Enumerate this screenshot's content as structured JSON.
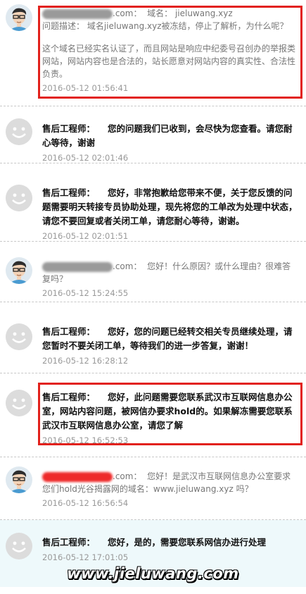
{
  "messages": [
    {
      "type": "user",
      "redacted_color": "gray",
      "domain_suffix": ".com：",
      "domain_label": "域名：",
      "domain_value": "jieluwang.xyz",
      "text1": "问题描述： 域名jieluwang.xyz被冻结，停止了解析，为什么呢？",
      "text2": "这个域名已经实名认证了，而且网站是响应中纪委号召创办的举报类网站，网站内容也是合法的，站长愿意对网站内容的真实性、合法性负责。",
      "time": "2016-05-12 01:56:41"
    },
    {
      "type": "engineer",
      "name": "售后工程师：",
      "text": "您的问题我们已收到，会尽快为您查看。请您耐心等待，谢谢",
      "time": "2016-05-12 02:01:46"
    },
    {
      "type": "engineer",
      "name": "售后工程师：",
      "text": "您好，非常抱歉给您带来不便，关于您反馈的问题需要明天转接专员协助处理，现先将您的工单改为处理中状态，请您不要回复或者关闭工单，请您耐心等待，谢谢。",
      "time": "2016-05-12 02:01:51"
    },
    {
      "type": "user",
      "redacted_color": "gray",
      "domain_suffix": ".com：",
      "text": "您好！什么原因？或什么理由？很难答复吗？",
      "time": "2016-05-12 15:24:55"
    },
    {
      "type": "engineer",
      "name": "售后工程师：",
      "text": "您好，您的问题已经转交相关专员继续处理，请您暂时不要关闭工单，等待我们的进一步答复，谢谢！",
      "time": "2016-05-12 16:28:12"
    },
    {
      "type": "engineer",
      "name": "售后工程师：",
      "text": "您好，此问题需要您联系武汉市互联网信息办公室，网站内容问题，被网信办要求hold的。如果解冻需要您联系武汉市互联网信息办公室，请您了解",
      "time": "2016-05-12 16:52:53"
    },
    {
      "type": "user",
      "redacted_color": "red",
      "domain_suffix": ".com：",
      "text": "您好！是武汉市互联网信息办公室要求您们hold光谷揭露网的域名：www.jieluwang.xyz 吗？",
      "time": "2016-05-12 16:56:54"
    },
    {
      "type": "engineer",
      "name": "售后工程师：",
      "text": "您好，是的，需要您联系网信办进行处理",
      "time": "2016-05-12 17:01:05"
    }
  ],
  "watermark": "www.jieluwang.com",
  "colors": {
    "highlight": "#e2211c",
    "redaction_gray": "#9a9a9a",
    "redaction_red": "#ee2a2a",
    "last_bg": "#eef9fb"
  }
}
